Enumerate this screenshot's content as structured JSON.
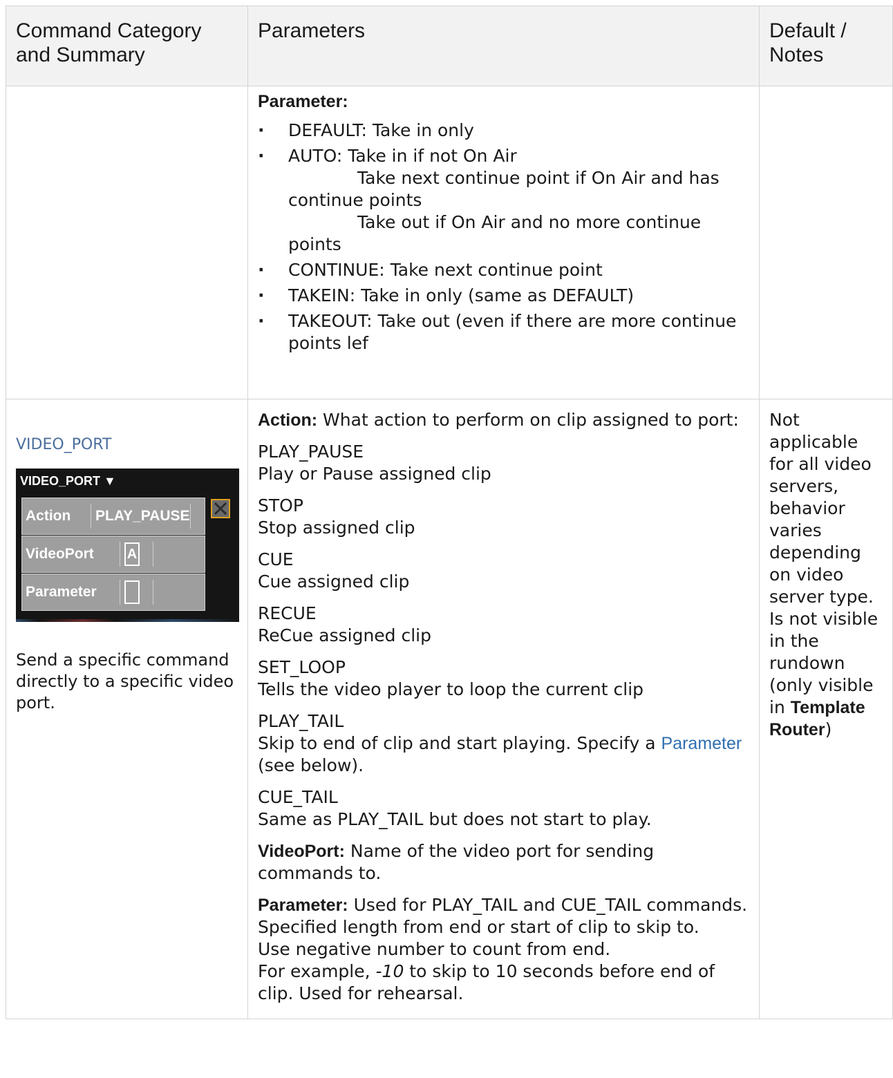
{
  "header": {
    "col1": "Command Category and Summary",
    "col2": "Parameters",
    "col3": "Default / Notes"
  },
  "row1": {
    "param_label": "Parameter:",
    "bullets": [
      "DEFAULT: Take in only",
      "AUTO: Take in if not On Air",
      "CONTINUE: Take next continue point",
      "TAKEIN: Take in only (same as DEFAULT)",
      "TAKEOUT: Take out (even if there are more continue points lef"
    ],
    "auto_sub1": "Take next continue point if On Air and has continue points",
    "auto_sub2": "Take out if On Air and no more continue points"
  },
  "row2": {
    "category": "VIDEO_PORT",
    "screenshot": {
      "title": "VIDEO_PORT ▼",
      "action_label": "Action",
      "action_value": "PLAY_PAUSE",
      "videoport_label": "VideoPort",
      "videoport_value": "A",
      "parameter_label": "Parameter"
    },
    "summary": "Send a specific command directly to a specific video port.",
    "action_label": "Action:",
    "action_desc": " What action to perform on clip assigned to port:",
    "actions": [
      {
        "name": "PLAY_PAUSE",
        "desc": "Play or Pause assigned clip"
      },
      {
        "name": "STOP",
        "desc": "Stop assigned clip"
      },
      {
        "name": "CUE",
        "desc": "Cue assigned clip"
      },
      {
        "name": "RECUE",
        "desc": "ReCue assigned clip"
      },
      {
        "name": "SET_LOOP",
        "desc": "Tells the video player to loop the current clip"
      }
    ],
    "play_tail_name": "PLAY_TAIL",
    "play_tail_desc_a": "Skip to end of clip and start playing. Specify a ",
    "play_tail_link": "Parameter",
    "play_tail_desc_b": " (see below).",
    "cue_tail_name": "CUE_TAIL",
    "cue_tail_desc": "Same as PLAY_TAIL but does not start to play.",
    "videoport_label": "VideoPort:",
    "videoport_desc": " Name of the video port for sending commands to.",
    "parameter_label": "Parameter:",
    "parameter_desc1": " Used for PLAY_TAIL and CUE_TAIL commands.",
    "parameter_desc2": "Specified length from end or start of clip to skip to.",
    "parameter_desc3": "Use negative number to count from end.",
    "parameter_desc4a": "For example, ",
    "parameter_example": "-10",
    "parameter_desc4b": " to skip to 10 seconds before end of clip. Used for rehearsal.",
    "notes_a": "Not applicable for all video servers, behavior varies depending on video server type. Is not visible in the rundown (only visible in ",
    "notes_link": "Template Router",
    "notes_b": ")"
  }
}
